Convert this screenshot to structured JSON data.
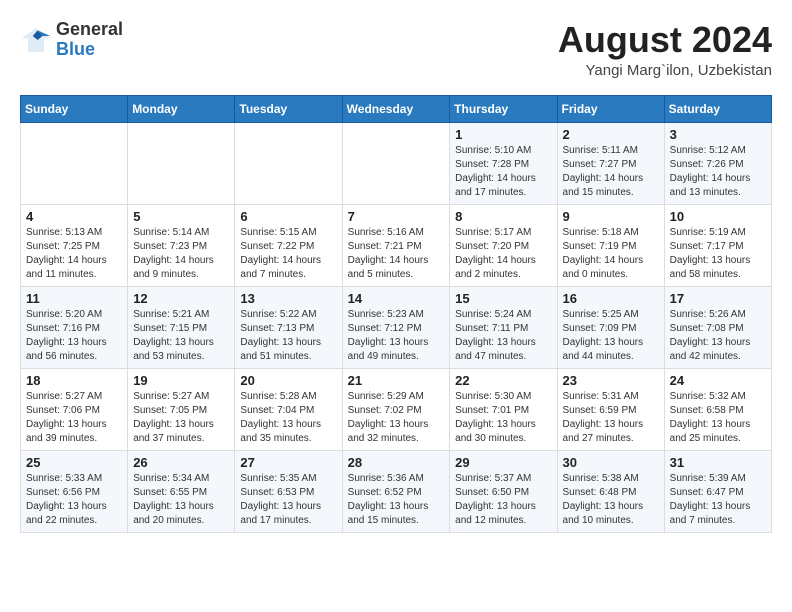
{
  "logo": {
    "line1": "General",
    "line2": "Blue"
  },
  "title": "August 2024",
  "location": "Yangi Marg`ilon, Uzbekistan",
  "days_of_week": [
    "Sunday",
    "Monday",
    "Tuesday",
    "Wednesday",
    "Thursday",
    "Friday",
    "Saturday"
  ],
  "weeks": [
    [
      {
        "day": "",
        "info": ""
      },
      {
        "day": "",
        "info": ""
      },
      {
        "day": "",
        "info": ""
      },
      {
        "day": "",
        "info": ""
      },
      {
        "day": "1",
        "info": "Sunrise: 5:10 AM\nSunset: 7:28 PM\nDaylight: 14 hours\nand 17 minutes."
      },
      {
        "day": "2",
        "info": "Sunrise: 5:11 AM\nSunset: 7:27 PM\nDaylight: 14 hours\nand 15 minutes."
      },
      {
        "day": "3",
        "info": "Sunrise: 5:12 AM\nSunset: 7:26 PM\nDaylight: 14 hours\nand 13 minutes."
      }
    ],
    [
      {
        "day": "4",
        "info": "Sunrise: 5:13 AM\nSunset: 7:25 PM\nDaylight: 14 hours\nand 11 minutes."
      },
      {
        "day": "5",
        "info": "Sunrise: 5:14 AM\nSunset: 7:23 PM\nDaylight: 14 hours\nand 9 minutes."
      },
      {
        "day": "6",
        "info": "Sunrise: 5:15 AM\nSunset: 7:22 PM\nDaylight: 14 hours\nand 7 minutes."
      },
      {
        "day": "7",
        "info": "Sunrise: 5:16 AM\nSunset: 7:21 PM\nDaylight: 14 hours\nand 5 minutes."
      },
      {
        "day": "8",
        "info": "Sunrise: 5:17 AM\nSunset: 7:20 PM\nDaylight: 14 hours\nand 2 minutes."
      },
      {
        "day": "9",
        "info": "Sunrise: 5:18 AM\nSunset: 7:19 PM\nDaylight: 14 hours\nand 0 minutes."
      },
      {
        "day": "10",
        "info": "Sunrise: 5:19 AM\nSunset: 7:17 PM\nDaylight: 13 hours\nand 58 minutes."
      }
    ],
    [
      {
        "day": "11",
        "info": "Sunrise: 5:20 AM\nSunset: 7:16 PM\nDaylight: 13 hours\nand 56 minutes."
      },
      {
        "day": "12",
        "info": "Sunrise: 5:21 AM\nSunset: 7:15 PM\nDaylight: 13 hours\nand 53 minutes."
      },
      {
        "day": "13",
        "info": "Sunrise: 5:22 AM\nSunset: 7:13 PM\nDaylight: 13 hours\nand 51 minutes."
      },
      {
        "day": "14",
        "info": "Sunrise: 5:23 AM\nSunset: 7:12 PM\nDaylight: 13 hours\nand 49 minutes."
      },
      {
        "day": "15",
        "info": "Sunrise: 5:24 AM\nSunset: 7:11 PM\nDaylight: 13 hours\nand 47 minutes."
      },
      {
        "day": "16",
        "info": "Sunrise: 5:25 AM\nSunset: 7:09 PM\nDaylight: 13 hours\nand 44 minutes."
      },
      {
        "day": "17",
        "info": "Sunrise: 5:26 AM\nSunset: 7:08 PM\nDaylight: 13 hours\nand 42 minutes."
      }
    ],
    [
      {
        "day": "18",
        "info": "Sunrise: 5:27 AM\nSunset: 7:06 PM\nDaylight: 13 hours\nand 39 minutes."
      },
      {
        "day": "19",
        "info": "Sunrise: 5:27 AM\nSunset: 7:05 PM\nDaylight: 13 hours\nand 37 minutes."
      },
      {
        "day": "20",
        "info": "Sunrise: 5:28 AM\nSunset: 7:04 PM\nDaylight: 13 hours\nand 35 minutes."
      },
      {
        "day": "21",
        "info": "Sunrise: 5:29 AM\nSunset: 7:02 PM\nDaylight: 13 hours\nand 32 minutes."
      },
      {
        "day": "22",
        "info": "Sunrise: 5:30 AM\nSunset: 7:01 PM\nDaylight: 13 hours\nand 30 minutes."
      },
      {
        "day": "23",
        "info": "Sunrise: 5:31 AM\nSunset: 6:59 PM\nDaylight: 13 hours\nand 27 minutes."
      },
      {
        "day": "24",
        "info": "Sunrise: 5:32 AM\nSunset: 6:58 PM\nDaylight: 13 hours\nand 25 minutes."
      }
    ],
    [
      {
        "day": "25",
        "info": "Sunrise: 5:33 AM\nSunset: 6:56 PM\nDaylight: 13 hours\nand 22 minutes."
      },
      {
        "day": "26",
        "info": "Sunrise: 5:34 AM\nSunset: 6:55 PM\nDaylight: 13 hours\nand 20 minutes."
      },
      {
        "day": "27",
        "info": "Sunrise: 5:35 AM\nSunset: 6:53 PM\nDaylight: 13 hours\nand 17 minutes."
      },
      {
        "day": "28",
        "info": "Sunrise: 5:36 AM\nSunset: 6:52 PM\nDaylight: 13 hours\nand 15 minutes."
      },
      {
        "day": "29",
        "info": "Sunrise: 5:37 AM\nSunset: 6:50 PM\nDaylight: 13 hours\nand 12 minutes."
      },
      {
        "day": "30",
        "info": "Sunrise: 5:38 AM\nSunset: 6:48 PM\nDaylight: 13 hours\nand 10 minutes."
      },
      {
        "day": "31",
        "info": "Sunrise: 5:39 AM\nSunset: 6:47 PM\nDaylight: 13 hours\nand 7 minutes."
      }
    ]
  ]
}
